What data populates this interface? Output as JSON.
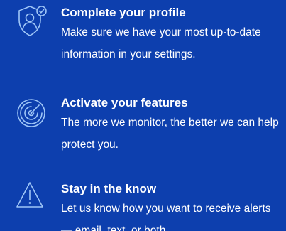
{
  "theme": {
    "background": "#0d3fae",
    "icon_color": "#9fc6f7",
    "text_color": "#ffffff"
  },
  "steps": [
    {
      "icon": "profile-shield-check-icon",
      "title": "Complete your profile",
      "description": "Make sure we have your most up-to-date information in your settings."
    },
    {
      "icon": "radar-icon",
      "title": "Activate your features",
      "description": "The more we monitor, the better we can help protect you."
    },
    {
      "icon": "alert-triangle-icon",
      "title": "Stay in the know",
      "description": "Let us know how you want to receive alerts — email, text, or both."
    }
  ]
}
